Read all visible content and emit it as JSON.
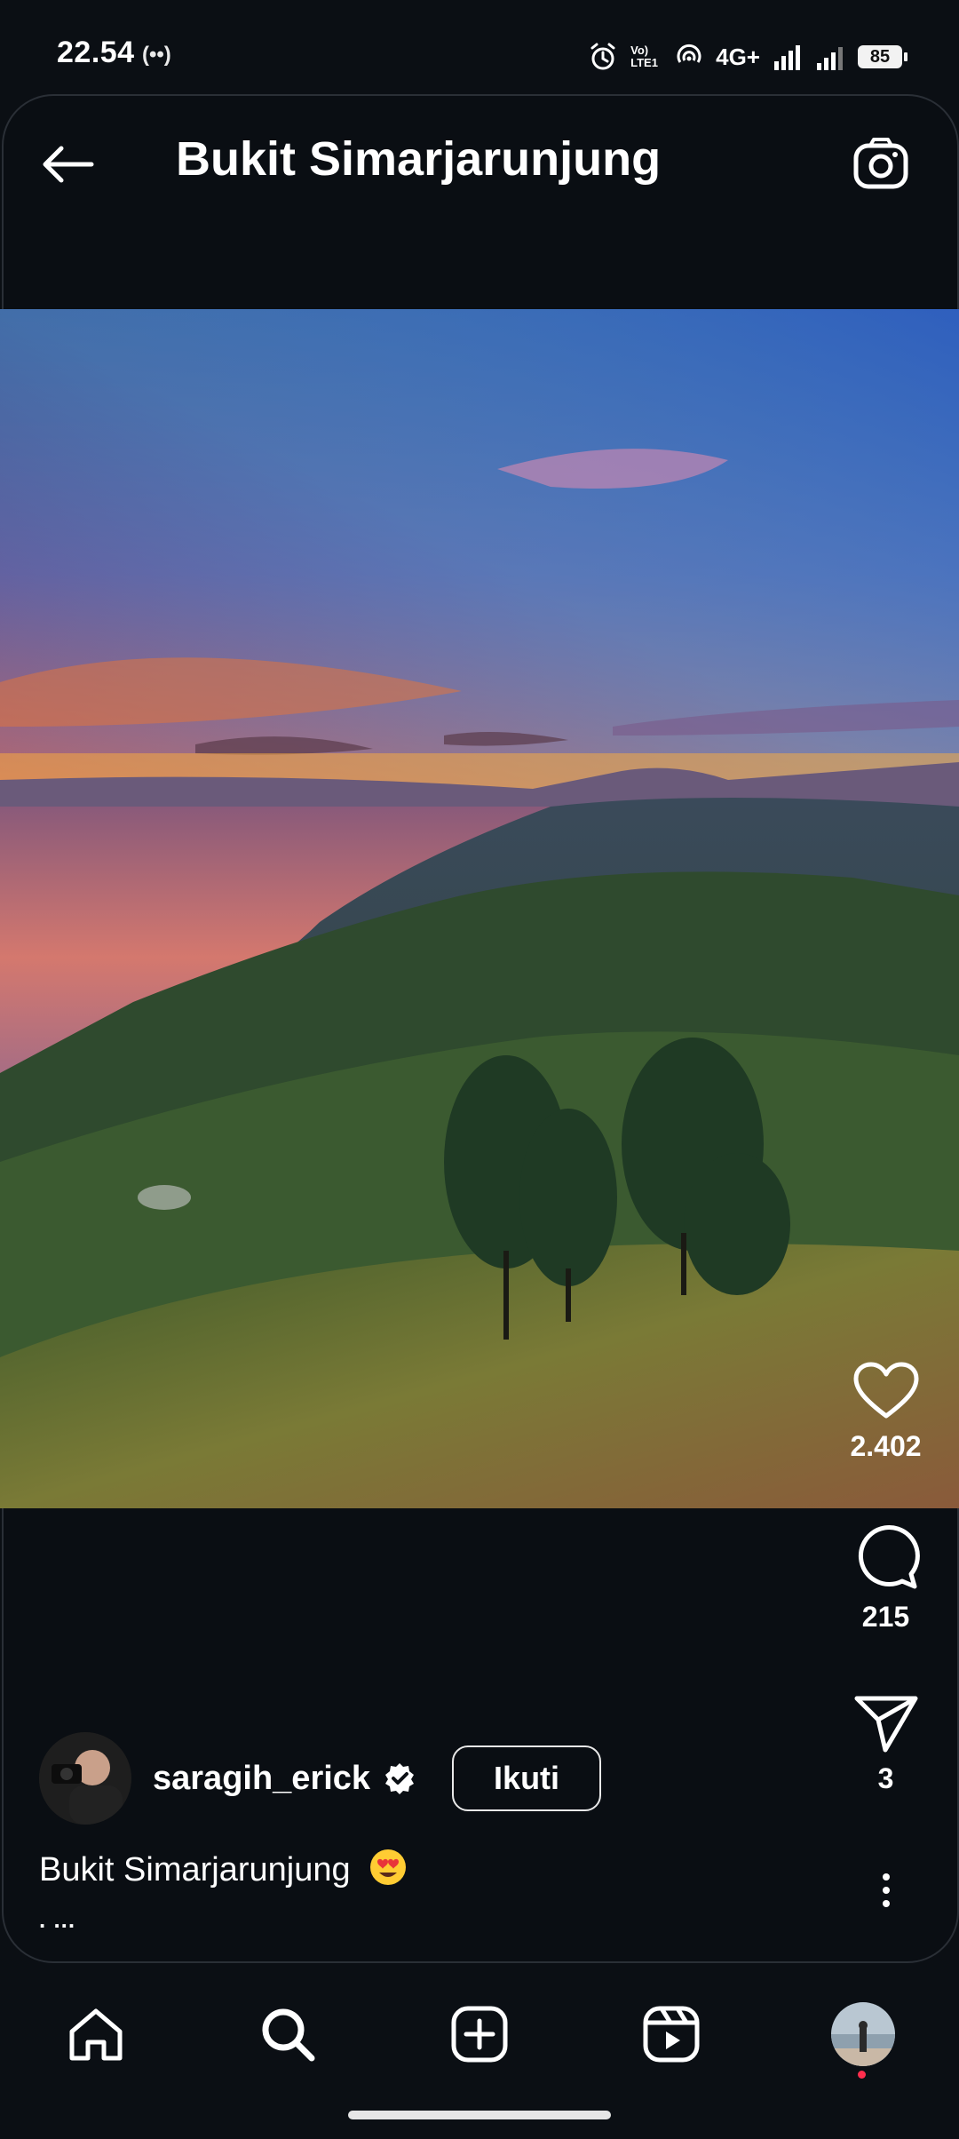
{
  "status_bar": {
    "time": "22.54",
    "radio_indicator": "(••)",
    "network": "4G+",
    "volte": "Vo) LTE1",
    "battery": "85"
  },
  "header": {
    "title": "Bukit Simarjarunjung",
    "back_icon": "arrow-left-icon",
    "camera_icon": "camera-icon"
  },
  "post": {
    "image_subject": "sunset-lake-toba-landscape",
    "likes": "2.402",
    "comments": "215",
    "shares": "3"
  },
  "author": {
    "username": "saragih_erick",
    "follow_label": "Ikuti"
  },
  "caption": {
    "text": "Bukit Simarjarunjung",
    "emoji": "heart-eyes-emoji",
    "more": ". ..."
  },
  "nav": {
    "items": [
      "home-icon",
      "search-icon",
      "add-icon",
      "reels-icon",
      "profile-avatar"
    ]
  },
  "colors": {
    "background": "#0b0f14",
    "notification_dot": "#ff2e4d",
    "verified_badge": "#ffffff"
  }
}
